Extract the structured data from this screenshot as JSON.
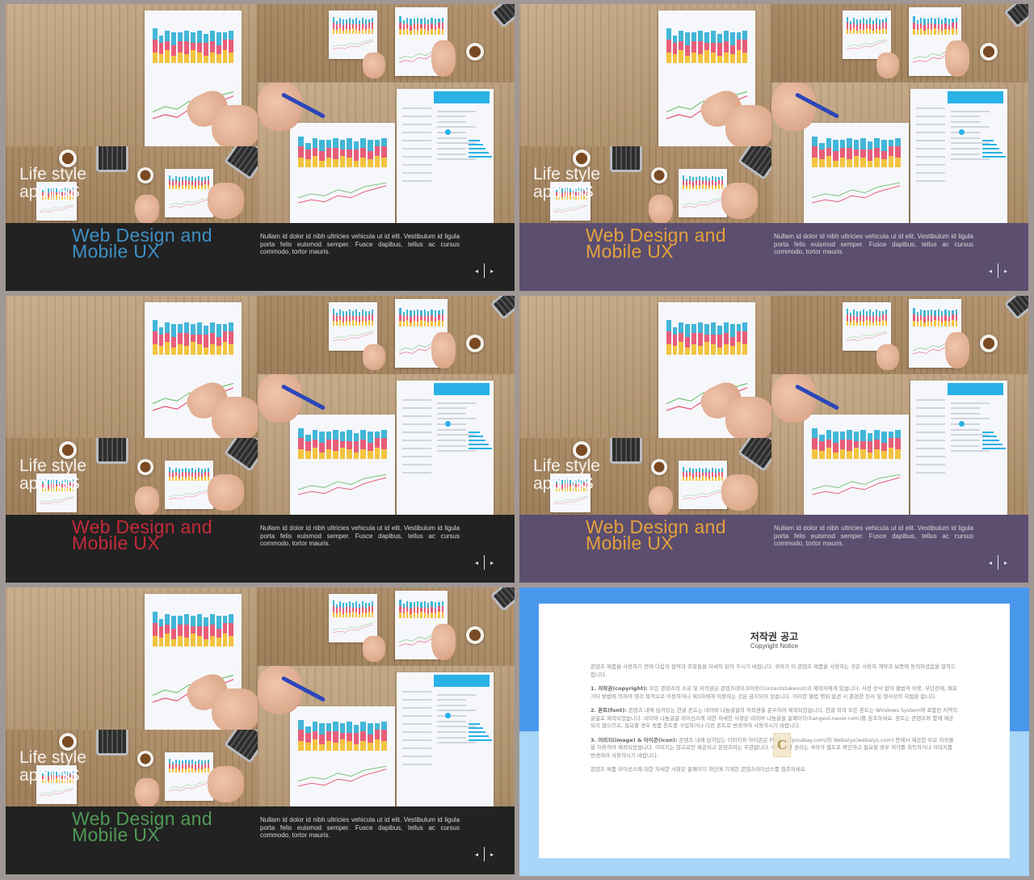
{
  "slides": [
    {
      "overlay": "Life style\napp ISS",
      "title_line1": "Web Design and",
      "title_line2": "Mobile UX",
      "description": "Nullam id dolor id nibh ultricies vehicula ut id elit. Vestibulum id ligula porta felis euismod semper. Fusce dapibus, tellus ac cursus commodo, tortor mauris.",
      "nav_prev": "◂",
      "nav_next": "▸",
      "footer_color": "#222222",
      "title_color": "#3f8fc4"
    },
    {
      "overlay": "Life style\napp ISS",
      "title_line1": "Web Design and",
      "title_line2": "Mobile UX",
      "description": "Nullam id dolor id nibh ultricies vehicula ut id elit. Vestibulum id ligula porta felis euismod semper. Fusce dapibus, tellus ac cursus commodo, tortor mauris.",
      "nav_prev": "◂",
      "nav_next": "▸",
      "footer_color": "#5b4e6f",
      "title_color": "#e6a13b"
    },
    {
      "overlay": "Life style\napp ISS",
      "title_line1": "Web Design and",
      "title_line2": "Mobile UX",
      "description": "Nullam id dolor id nibh ultricies vehicula ut id elit. Vestibulum id ligula porta felis euismod semper. Fusce dapibus, tellus ac cursus commodo, tortor mauris.",
      "nav_prev": "◂",
      "nav_next": "▸",
      "footer_color": "#222222",
      "title_color": "#c42a3a"
    },
    {
      "overlay": "Life style\napp ISS",
      "title_line1": "Web Design and",
      "title_line2": "Mobile UX",
      "description": "Nullam id dolor id nibh ultricies vehicula ut id elit. Vestibulum id ligula porta felis euismod semper. Fusce dapibus, tellus ac cursus commodo, tortor mauris.",
      "nav_prev": "◂",
      "nav_next": "▸",
      "footer_color": "#5b4e6f",
      "title_color": "#e6a13b"
    },
    {
      "overlay": "Life style\napp ISS",
      "title_line1": "Web Design and",
      "title_line2": "Mobile UX",
      "description": "Nullam id dolor id nibh ultricies vehicula ut id elit. Vestibulum id ligula porta felis euismod semper. Fusce dapibus, tellus ac cursus commodo, tortor mauris.",
      "nav_prev": "◂",
      "nav_next": "▸",
      "footer_color": "#222222",
      "title_color": "#4f9a55"
    }
  ],
  "copyright": {
    "title": "저작권 공고",
    "subtitle": "Copyright Notice",
    "intro": "콘텐츠 제품을 사용하기 전에 다음의 협약과 조항들을 자세히 읽어 주시기 바랍니다. 귀하가 이 콘텐츠 제품을 사용하는 것은 사용자 계약과 보증에 동의하셨음을 말하드립니다.",
    "section1_head": "1. 저작권(copyright):",
    "section1": "모든 콘텐츠의 소유 및 저작권은 콘텐츠테이크아웃(Contentstakeout)과 제작자에게 있습니다. 사전 승낙 없이 불법적 이용, 무단전재, 배포 기타 방법에 의하여 영리 목적으로 이용하거나 제3자에게 이용하는 것은 금지되어 있습니다. 이러한 불법 행위 발견 시 준엄한 민사 및 형사상의 처벌을 합니다.",
    "section2_head": "2. 폰트(font):",
    "section2": "콘텐츠 내에 담겨있는 한글 폰트는 네이버 나눔글꼴의 저작권을 준수하여 제작되었습니다. 한글 외의 모든 폰트는 Windows System에 포함된 지역의 글꼴로 제작되었습니다. 네이버 나눔글꼴 라이선스에 대한 자세한 사항은 네이버 나눔글꼴 홈페이지(hangeul.naver.com)를 참조하세요. 폰트는 콘텐츠와 함께 제공되지 않으므로, 필요할 경우 정품 폰트를 구입하거나 다른 폰트로 변경하여 사용하시기 바랍니다.",
    "section3_head": "3. 이미지(image) & 아이콘(icon):",
    "section3": "콘텐츠 내에 담겨있는 이미지와 아이콘은 Pixabay(pixabay.com)와 Webalys(webalys.com) 등에서 제공한 무료 저작물을 이용하여 제작되었습니다. 이미지는 참고로만 제공되고 콘텐츠와는 무관합니다. 이에 관한 권리는 귀하가 별도로 확인하고 필요할 경우 허가를 취득하거나 이미지를 변경하여 사용하시기 바랍니다.",
    "closing": "콘텐츠 제품 라이선스에 대한 자세한 사항은 홈페이지 하단에 기재한 콘텐츠라이선스를 참조하세요.",
    "logo_letter": "C"
  }
}
